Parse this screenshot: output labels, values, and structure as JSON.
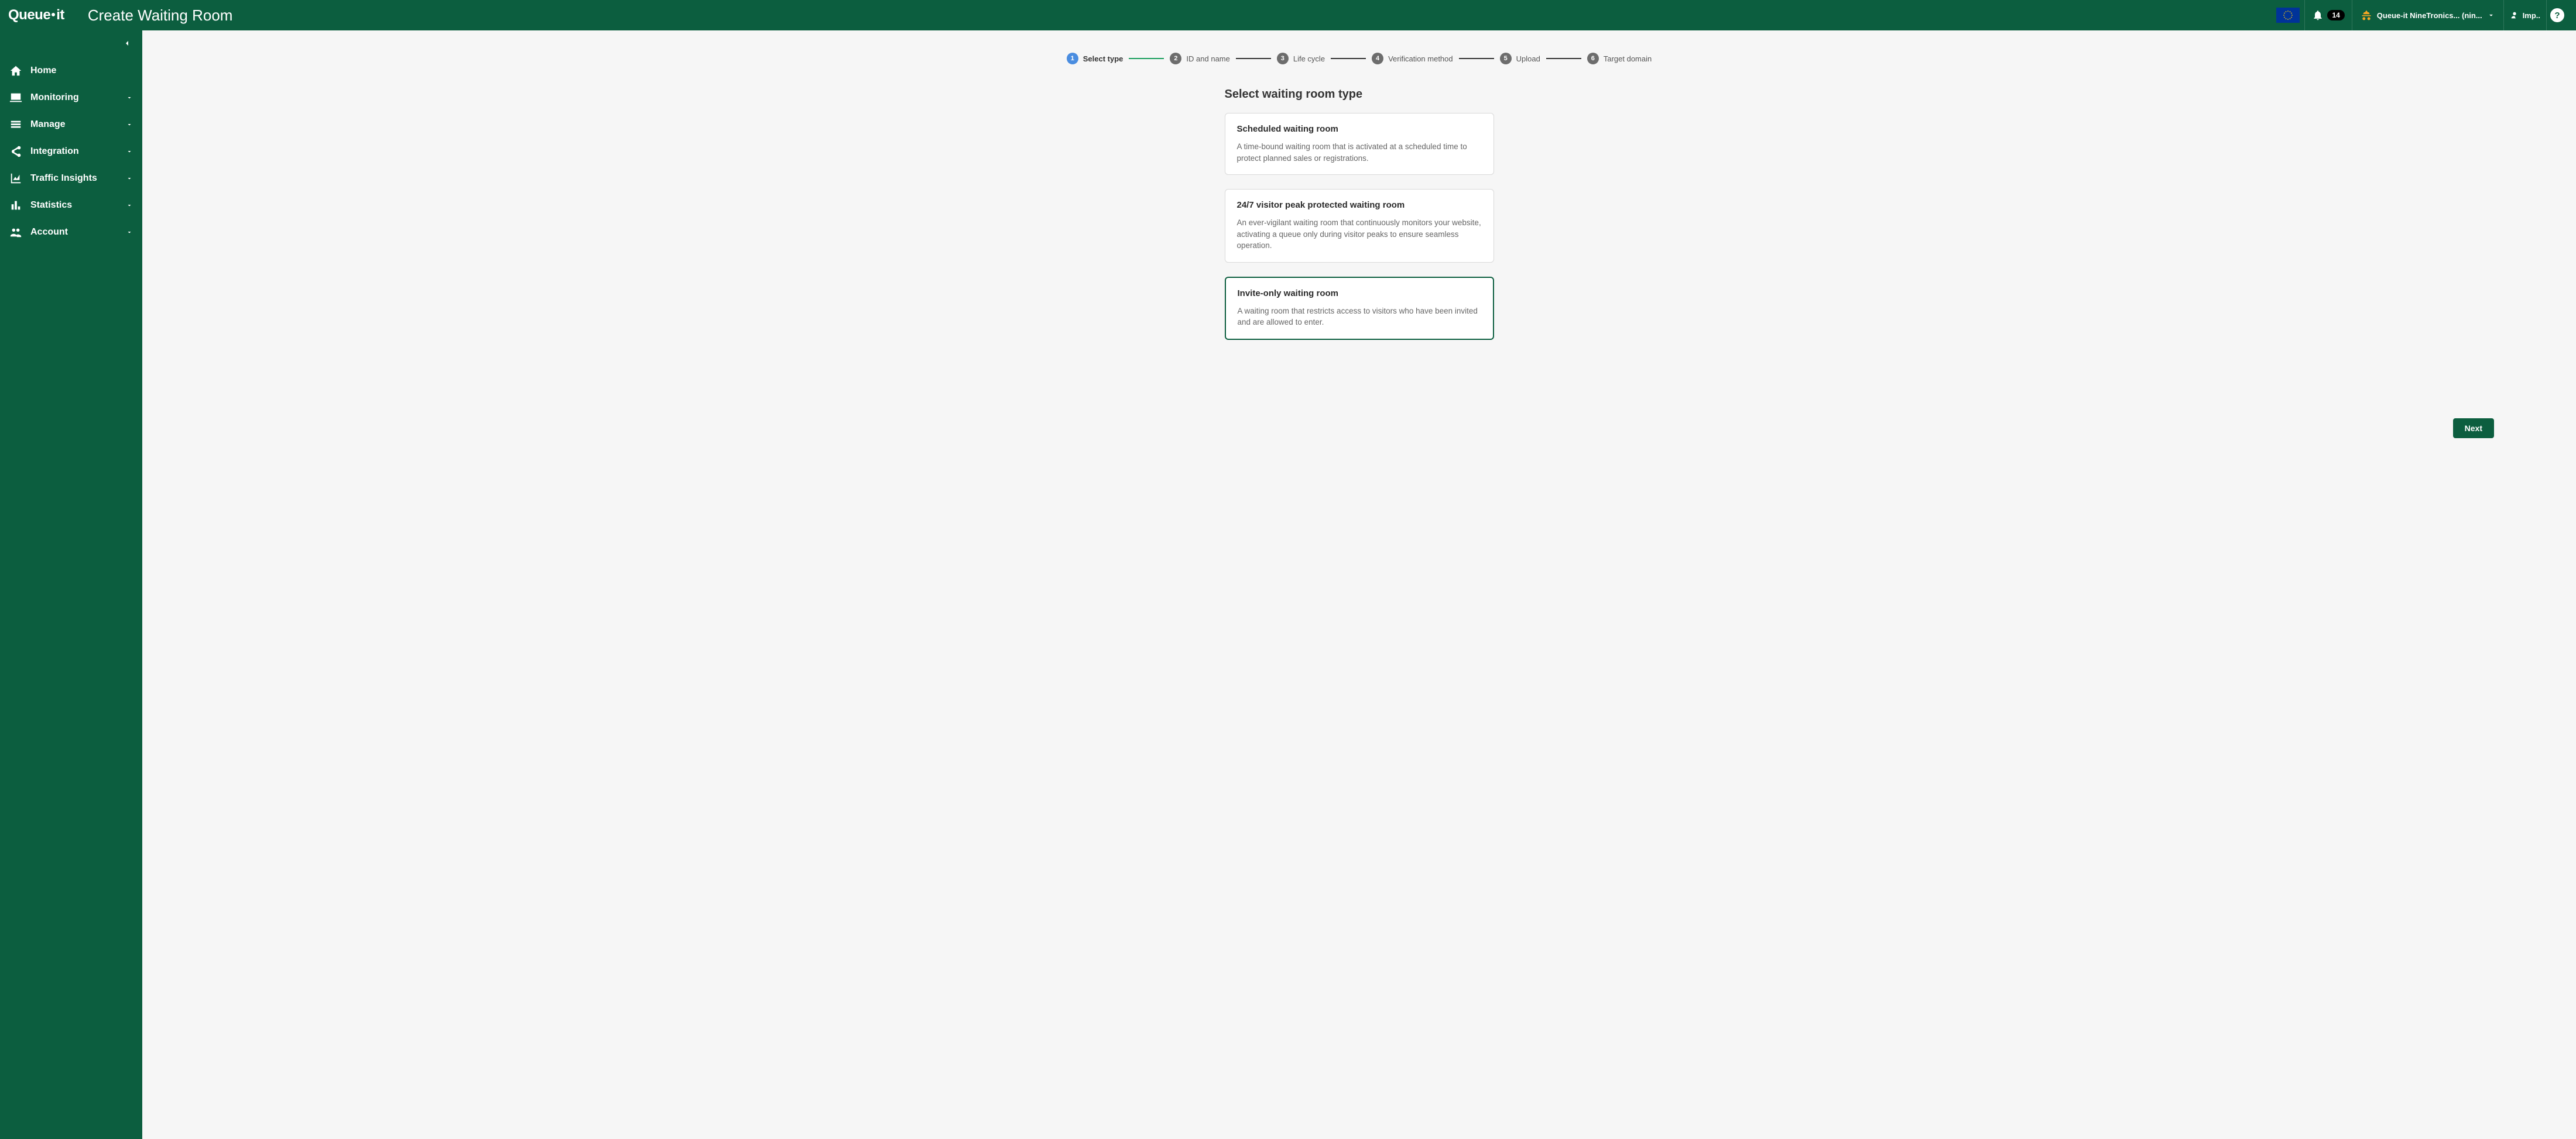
{
  "header": {
    "brand": "Queue·it",
    "page_title": "Create Waiting Room",
    "notif_count": "14",
    "account_label": "Queue-it NineTronics... (nin...",
    "imp_label": "Imp..",
    "help_label": "?"
  },
  "sidebar": {
    "items": [
      {
        "label": "Home",
        "has_caret": false
      },
      {
        "label": "Monitoring",
        "has_caret": true
      },
      {
        "label": "Manage",
        "has_caret": true
      },
      {
        "label": "Integration",
        "has_caret": true
      },
      {
        "label": "Traffic Insights",
        "has_caret": true
      },
      {
        "label": "Statistics",
        "has_caret": true
      },
      {
        "label": "Account",
        "has_caret": true
      }
    ]
  },
  "stepper": {
    "steps": [
      {
        "num": "1",
        "label": "Select type"
      },
      {
        "num": "2",
        "label": "ID and name"
      },
      {
        "num": "3",
        "label": "Life cycle"
      },
      {
        "num": "4",
        "label": "Verification method"
      },
      {
        "num": "5",
        "label": "Upload"
      },
      {
        "num": "6",
        "label": "Target domain"
      }
    ]
  },
  "content": {
    "section_title": "Select waiting room type",
    "cards": [
      {
        "title": "Scheduled waiting room",
        "desc": "A time-bound waiting room that is activated at a scheduled time to protect planned sales or registrations."
      },
      {
        "title": "24/7 visitor peak protected waiting room",
        "desc": "An ever-vigilant waiting room that continuously monitors your website, activating a queue only during visitor peaks to ensure seamless operation."
      },
      {
        "title": "Invite-only waiting room",
        "desc": "A waiting room that restricts access to visitors who have been invited and are allowed to enter."
      }
    ],
    "selected_index": 2
  },
  "footer": {
    "next_label": "Next"
  }
}
